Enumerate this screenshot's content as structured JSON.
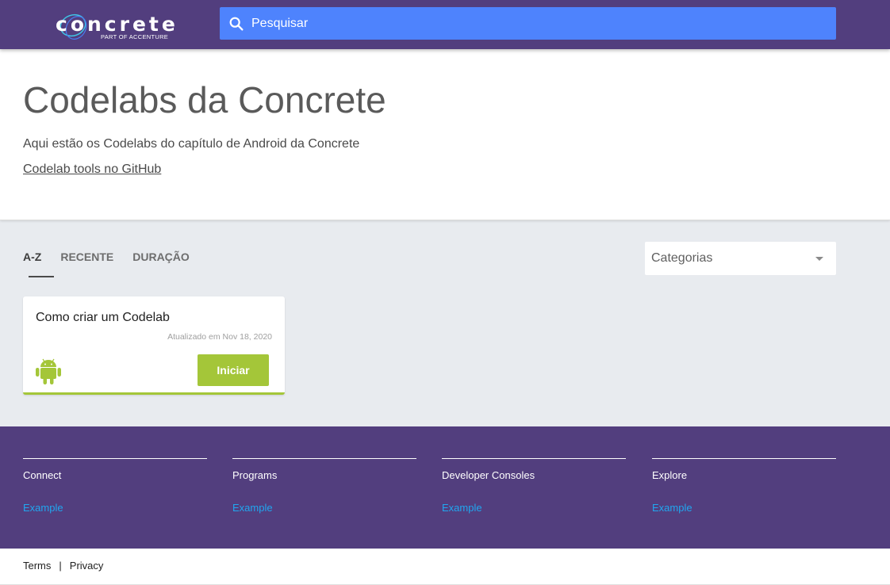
{
  "header": {
    "logo_text": "concrete",
    "logo_subtext": "PART OF ACCENTURE",
    "search_placeholder": "Pesquisar",
    "icons": {
      "search": "search-icon",
      "logo": "concrete-logo"
    }
  },
  "intro": {
    "title": "Codelabs da Concrete",
    "description": "Aqui estão os Codelabs do capítulo de Android da Concrete",
    "link_label": "Codelab tools no GitHub"
  },
  "filters": {
    "tabs": [
      {
        "label": "A-Z",
        "active": true
      },
      {
        "label": "RECENTE",
        "active": false
      },
      {
        "label": "DURAÇÃO",
        "active": false
      }
    ],
    "categories_label": "Categorias"
  },
  "cards": [
    {
      "title": "Como criar um Codelab",
      "updated": "Atualizado em Nov 18, 2020",
      "category_icon": "android-icon",
      "button_label": "Iniciar",
      "accent_color": "#a4c639"
    }
  ],
  "footer": {
    "columns": [
      {
        "title": "Connect",
        "link": "Example"
      },
      {
        "title": "Programs",
        "link": "Example"
      },
      {
        "title": "Developer Consoles",
        "link": "Example"
      },
      {
        "title": "Explore",
        "link": "Example"
      }
    ],
    "legal": {
      "terms": "Terms",
      "separator": "|",
      "privacy": "Privacy"
    }
  },
  "colors": {
    "brand_purple": "#523e7e",
    "search_blue": "#4e83fd",
    "android_green": "#a4c639",
    "link_blue": "#21a6ef",
    "page_background": "#e8ebef"
  }
}
